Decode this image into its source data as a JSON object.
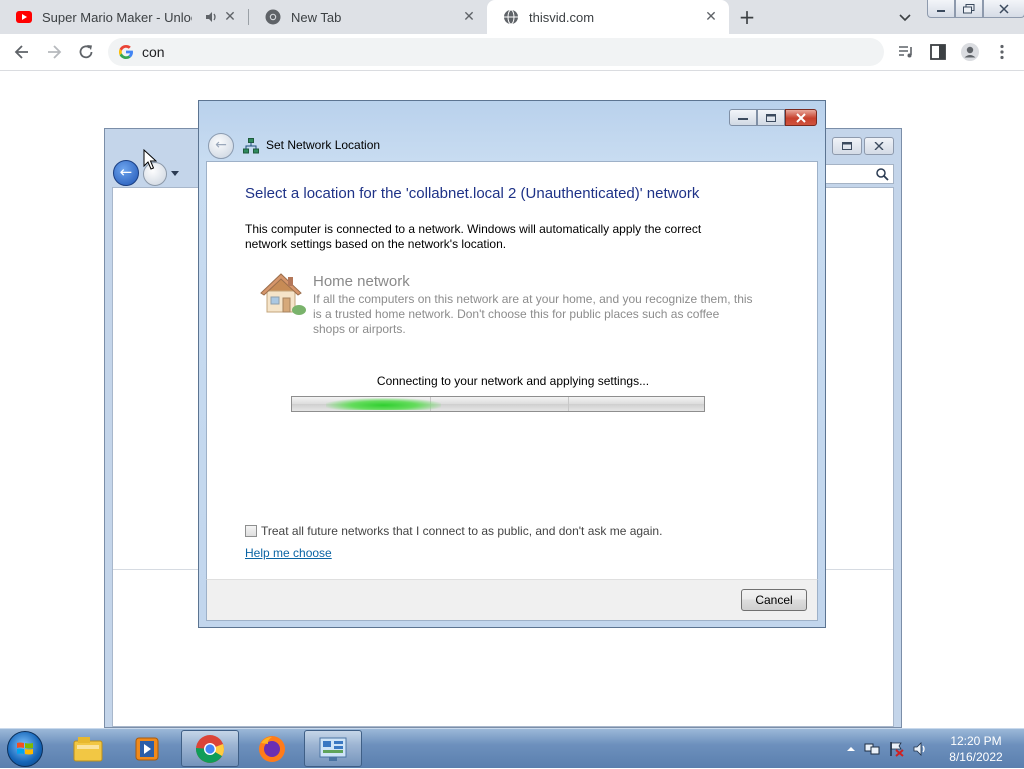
{
  "browser": {
    "tabs": [
      {
        "title": "Super Mario Maker - Unlock",
        "favicon": "youtube-icon",
        "audio": true
      },
      {
        "title": "New Tab",
        "favicon": "chrome-icon"
      },
      {
        "title": "thisvid.com",
        "favicon": "globe-icon",
        "active": true
      }
    ],
    "address": "con"
  },
  "dialog": {
    "title": "Set Network Location",
    "heading": "Select a location for the 'collabnet.local  2 (Unauthenticated)' network",
    "description": "This computer is connected to a network. Windows will automatically apply the correct network settings based on the network's location.",
    "option": {
      "title": "Home network",
      "description": "If all the computers on this network are at your home, and you recognize them, this is a trusted home network.  Don't choose this for public places such as coffee shops or airports.",
      "icon": "house-icon"
    },
    "status": "Connecting to your network and applying settings...",
    "progress_fraction": 0.25,
    "checkbox_label": "Treat all future networks that I connect to as public, and don't ask me again.",
    "checkbox_checked": false,
    "help_link": "Help me choose",
    "cancel_label": "Cancel"
  },
  "taskbar": {
    "apps": [
      "file-explorer-icon",
      "media-player-icon",
      "chrome-icon",
      "firefox-icon",
      "control-panel-icon"
    ],
    "time": "12:20 PM",
    "date": "8/16/2022"
  }
}
